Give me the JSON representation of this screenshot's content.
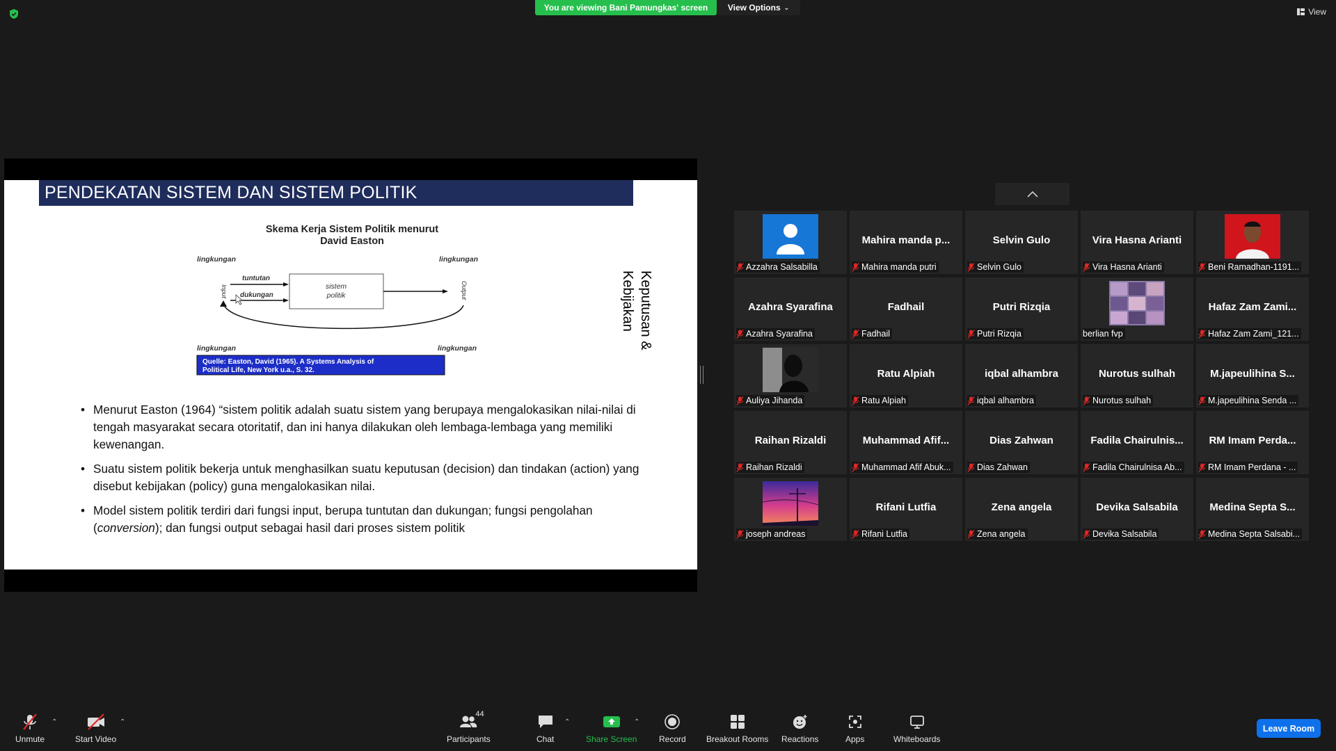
{
  "top": {
    "banner": "You are viewing Bani Pamungkas' screen",
    "view_options": "View Options",
    "view": "View",
    "colors": {
      "banner": "#26bf4d",
      "leave": "#0e71eb"
    }
  },
  "slide": {
    "title": "PENDEKATAN SISTEM DAN SISTEM POLITIK",
    "diagram": {
      "heading_line1": "Skema Kerja Sistem Politik menurut",
      "heading_line2": "David Easton",
      "env_top_left": "lingkungan",
      "env_top_right": "lingkungan",
      "env_bottom_left": "lingkungan",
      "env_bottom_right": "lingkungan",
      "tuntutan": "tuntutan",
      "dukungan": "dukungan",
      "box_line1": "sistem",
      "box_line2": "politik",
      "input": "Input",
      "output": "Output",
      "source_line1": "Quelle: Easton, David (1965). A Systems Analysis of",
      "source_line2": "Political Life, New York u.a., S. 32."
    },
    "vertical_line1": "Keputusan &",
    "vertical_line2": "Kebijakan",
    "bullets": [
      {
        "text": "Menurut Easton (1964) “sistem politik adalah suatu sistem yang berupaya mengalokasikan nilai-nilai di tengah masyarakat secara otoritatif, dan ini hanya dilakukan oleh lembaga-lembaga yang memiliki kewenangan."
      },
      {
        "text": "Suatu sistem politik bekerja untuk menghasilkan suatu keputusan (decision) dan tindakan (action) yang disebut kebijakan (policy) guna mengalokasikan nilai."
      },
      {
        "text_a": "Model sistem politik terdiri dari fungsi input, berupa tuntutan dan dukungan; fungsi pengolahan (",
        "text_em": "conversion",
        "text_b": "); dan fungsi output sebagai hasil dari proses sistem politik"
      }
    ]
  },
  "gallery": {
    "tiles": [
      {
        "big": "",
        "label": "Azzahra Salsabilla",
        "muted": true,
        "pic": "avatar"
      },
      {
        "big": "Mahira  manda  p...",
        "label": "Mahira manda putri",
        "muted": true
      },
      {
        "big": "Selvin Gulo",
        "label": "Selvin Gulo",
        "muted": true
      },
      {
        "big": "Vira Hasna Arianti",
        "label": "Vira Hasna Arianti",
        "muted": true
      },
      {
        "big": "",
        "label": "Beni Ramadhan-1191...",
        "muted": true,
        "pic": "red"
      },
      {
        "big": "Azahra Syarafina",
        "label": "Azahra Syarafina",
        "muted": true
      },
      {
        "big": "Fadhail",
        "label": "Fadhail",
        "muted": true
      },
      {
        "big": "Putri Rizqia",
        "label": "Putri Rizqia",
        "muted": true
      },
      {
        "big": "",
        "label": "berlian fvp",
        "muted": false,
        "pic": "collage"
      },
      {
        "big": "Hafaz Zam Zami...",
        "label": "Hafaz Zam Zami_121...",
        "muted": true
      },
      {
        "big": "",
        "label": "Auliya Jihanda",
        "muted": true,
        "pic": "dark"
      },
      {
        "big": "Ratu Alpiah",
        "label": "Ratu Alpiah",
        "muted": true
      },
      {
        "big": "iqbal alhambra",
        "label": "iqbal alhambra",
        "muted": true
      },
      {
        "big": "Nurotus sulhah",
        "label": "Nurotus sulhah",
        "muted": true
      },
      {
        "big": "M.japeulihina  S...",
        "label": "M.japeulihina Senda ...",
        "muted": true
      },
      {
        "big": "Raihan Rizaldi",
        "label": "Raihan Rizaldi",
        "muted": true
      },
      {
        "big": "Muhammad  Afif...",
        "label": "Muhammad Afif Abuk...",
        "muted": true
      },
      {
        "big": "Dias Zahwan",
        "label": "Dias Zahwan",
        "muted": true
      },
      {
        "big": "Fadila  Chairulnis...",
        "label": "Fadila Chairulnisa Ab...",
        "muted": true
      },
      {
        "big": "RM Imam Perda...",
        "label": "RM Imam Perdana - ...",
        "muted": true
      },
      {
        "big": "",
        "label": "joseph andreas",
        "muted": true,
        "pic": "sunset"
      },
      {
        "big": "Rifani Lutfia",
        "label": "Rifani Lutfia",
        "muted": true
      },
      {
        "big": "Zena angela",
        "label": "Zena angela",
        "muted": true
      },
      {
        "big": "Devika Salsabila",
        "label": "Devika Salsabila",
        "muted": true
      },
      {
        "big": "Medina  Septa  S...",
        "label": "Medina Septa Salsabi...",
        "muted": true
      }
    ]
  },
  "toolbar": {
    "unmute": "Unmute",
    "start_video": "Start Video",
    "participants": "Participants",
    "participants_count": "44",
    "chat": "Chat",
    "share_screen": "Share Screen",
    "record": "Record",
    "breakout_rooms": "Breakout Rooms",
    "reactions": "Reactions",
    "apps": "Apps",
    "whiteboards": "Whiteboards",
    "leave_room": "Leave Room"
  }
}
